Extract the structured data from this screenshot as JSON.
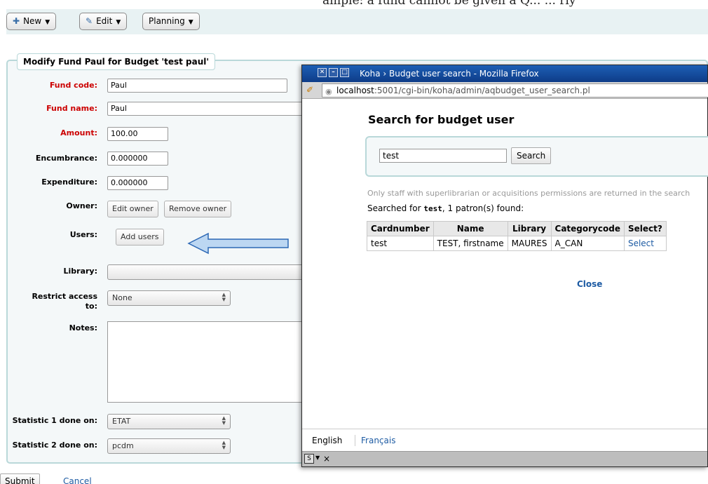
{
  "cut_text": "ample: a fund cannot be given a Q... ...  rly",
  "toolbar": {
    "new_label": "New",
    "edit_label": "Edit",
    "planning_label": "Planning"
  },
  "form": {
    "legend": "Modify Fund Paul for Budget 'test paul'",
    "fund_code_label": "Fund code:",
    "fund_code_value": "Paul",
    "fund_name_label": "Fund name:",
    "fund_name_value": "Paul",
    "amount_label": "Amount:",
    "amount_value": "100.00",
    "encumbrance_label": "Encumbrance:",
    "encumbrance_value": "0.000000",
    "expenditure_label": "Expenditure:",
    "expenditure_value": "0.000000",
    "owner_label": "Owner:",
    "edit_owner_label": "Edit owner",
    "remove_owner_label": "Remove owner",
    "users_label": "Users:",
    "add_users_label": "Add users",
    "library_label": "Library:",
    "library_value": "",
    "restrict_label_1": "Restrict access",
    "restrict_label_2": "to:",
    "restrict_value": "None",
    "notes_label": "Notes:",
    "stat1_label": "Statistic 1 done on:",
    "stat1_value": "ETAT",
    "stat2_label": "Statistic 2 done on:",
    "stat2_value": "pcdm",
    "submit_label": "Submit",
    "cancel_label": "Cancel"
  },
  "popup": {
    "window_title": "Koha › Budget user search - Mozilla Firefox",
    "url_host": "localhost",
    "url_rest": ":5001/cgi-bin/koha/admin/aqbudget_user_search.pl",
    "page_title": "Search for budget user",
    "search_value": "test",
    "search_button": "Search",
    "info_text": "Only staff with superlibrarian or acquisitions permissions are returned in the search",
    "found_prefix": "Searched for",
    "found_term": "test",
    "found_suffix": ", 1 patron(s) found:",
    "table": {
      "headers": [
        "Cardnumber",
        "Name",
        "Library",
        "Categorycode",
        "Select?"
      ],
      "rows": [
        [
          "test",
          "TEST, firstname",
          "MAURES",
          "A_CAN",
          "Select"
        ]
      ]
    },
    "close_label": "Close",
    "lang_english": "English",
    "lang_french": "Français"
  },
  "colors": {
    "required_label": "#cc0000",
    "link": "#1d5ba3",
    "titlebar": "#1d5fb5",
    "fieldset_border": "#b9d8d9"
  }
}
